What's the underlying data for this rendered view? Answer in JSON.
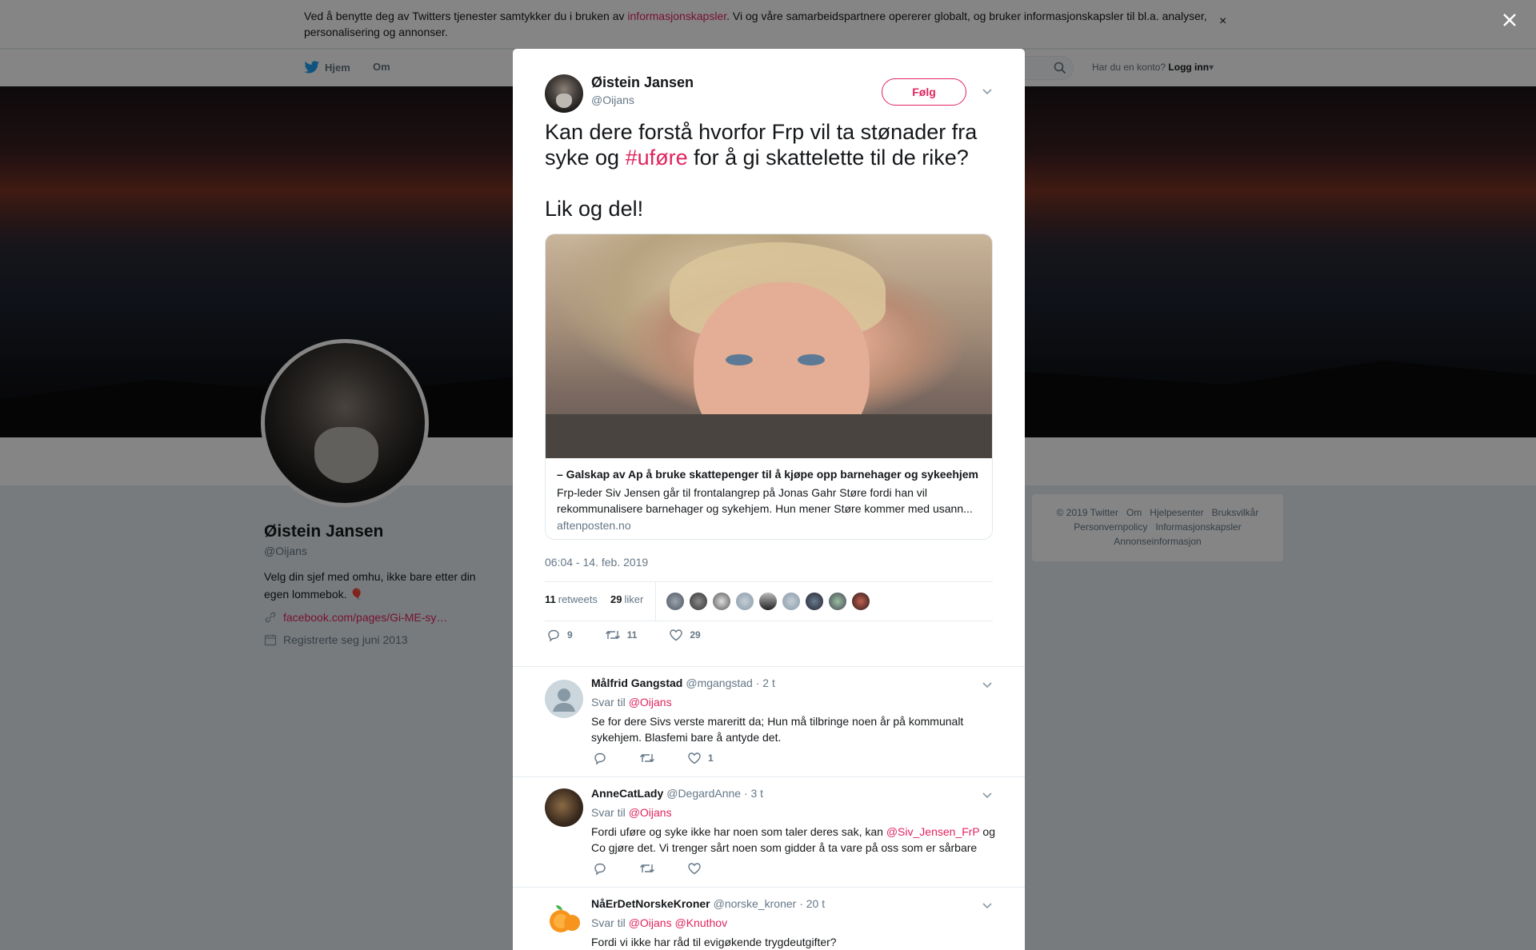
{
  "cookie_bar": {
    "text_before": "Ved å benytte deg av Twitters tjenester samtykker du i bruken av ",
    "link": "informasjonskapsler",
    "text_after": ". Vi og våre samarbeidspartnere opererer globalt, og bruker informasjonskapsler til bl.a. analyser, personalisering og annonser.",
    "close": "×"
  },
  "nav": {
    "home": "Hjem",
    "about": "Om",
    "login_prompt": "Har du en konto?",
    "login": "Logg inn"
  },
  "profile": {
    "name": "Øistein Jansen",
    "handle": "@Oijans",
    "bio": "Velg din sjef med omhu, ikke bare etter din egen lommebok.",
    "bio_emoji": "🎈",
    "link": "facebook.com/pages/Gi-ME-sy…",
    "joined": "Registrerte seg juni 2013"
  },
  "footer": {
    "links": [
      "© 2019 Twitter",
      "Om",
      "Hjelpesenter",
      "Bruksvilkår",
      "Personvernpolicy",
      "Informasjonskapsler",
      "Annonseinformasjon"
    ]
  },
  "tweet": {
    "author_name": "Øistein Jansen",
    "author_handle": "@Oijans",
    "follow_label": "Følg",
    "text_part1": "Kan dere forstå hvorfor Frp vil ta stønader fra syke og ",
    "hashtag": "#uføre",
    "text_part2": " for å gi skattelette til de rike?",
    "text_line2": "Lik og del!",
    "card": {
      "title": "– Galskap av Ap å bruke skattepenger til å kjøpe opp barnehager og sykeehjem",
      "description": "Frp-leder Siv Jensen går til frontalangrep på Jonas Gahr Støre fordi han vil rekommunalisere barnehager og sykehjem. Hun mener Støre kommer med usann...",
      "domain": "aftenposten.no"
    },
    "timestamp": "06:04 - 14. feb. 2019",
    "retweets_count": "11",
    "retweets_label": "retweets",
    "likes_count": "29",
    "likes_label": "liker",
    "actions": {
      "reply_count": "9",
      "retweet_count": "11",
      "like_count": "29"
    }
  },
  "replies": [
    {
      "name": "Målfrid Gangstad",
      "handle": "@mgangstad",
      "time": "· 2 t",
      "reply_to_label": "Svar til",
      "reply_to": "@Oijans",
      "text": "Se for dere Sivs verste mareritt da; Hun må tilbringe noen år på kommunalt sykehjem. Blasfemi bare å antyde det.",
      "like_count": "1"
    },
    {
      "name": "AnneCatLady",
      "handle": "@DegardAnne",
      "time": "· 3 t",
      "reply_to_label": "Svar til",
      "reply_to": "@Oijans",
      "text_before": "Fordi uføre og syke ikke har noen som taler deres sak, kan ",
      "mention": "@Siv_Jensen_FrP",
      "text_after": " og Co gjøre det. Vi trenger sårt noen som gidder å ta vare på oss som er sårbare",
      "like_count": ""
    },
    {
      "name": "NåErDetNorskeKroner",
      "handle": "@norske_kroner",
      "time": "· 20 t",
      "reply_to_label": "Svar til",
      "reply_to": "@Oijans",
      "reply_to_2": "@Knuthov",
      "text": "Fordi vi ikke har råd til evigøkende trygdeutgifter?"
    }
  ],
  "colors": {
    "accent": "#e0245e",
    "muted": "#657786",
    "text": "#14171a"
  }
}
